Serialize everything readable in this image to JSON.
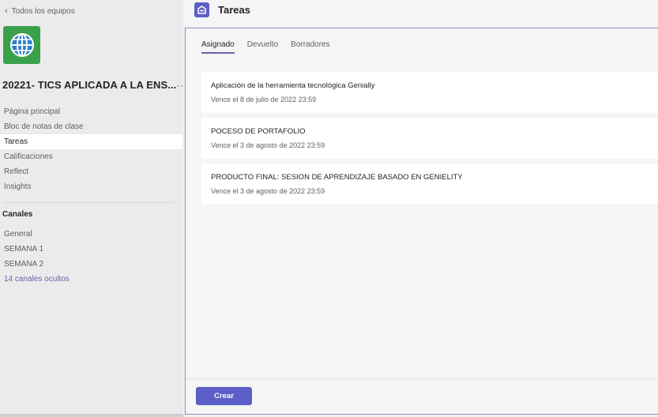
{
  "sidebar": {
    "back_label": "Todos los equipos",
    "team_name": "20221- TICS APLICADA A LA ENS...",
    "more_label": "···",
    "nav_items": [
      {
        "label": "Página principal"
      },
      {
        "label": "Bloc de notas de clase"
      },
      {
        "label": "Tareas"
      },
      {
        "label": "Calificaciones"
      },
      {
        "label": "Reflect"
      },
      {
        "label": "Insights"
      }
    ],
    "active_nav": "Tareas",
    "channels_title": "Canales",
    "channels": [
      {
        "label": "General"
      },
      {
        "label": "SEMANA 1"
      },
      {
        "label": "SEMANA 2"
      },
      {
        "label": "14 canales ocultos"
      }
    ]
  },
  "header": {
    "title": "Tareas",
    "icon": "assignments-icon"
  },
  "tabs": [
    {
      "label": "Asignado"
    },
    {
      "label": "Devuelto"
    },
    {
      "label": "Borradores"
    }
  ],
  "active_tab": "Asignado",
  "assignments": [
    {
      "title": "Aplicación de la herramienta tecnológica Genially",
      "due": "Vence el 8 de julio de 2022 23:59"
    },
    {
      "title": "POCESO DE PORTAFOLIO",
      "due": "Vence el 3 de agosto de 2022 23:59"
    },
    {
      "title": "PRODUCTO FINAL: SESION DE APRENDIZAJE BASADO EN GENIELITY",
      "due": "Vence el 3 de agosto de 2022 23:59"
    }
  ],
  "create_button": "Crear",
  "colors": {
    "accent": "#5b5fc7",
    "team_avatar": "#3aa14a",
    "link": "#6264a7"
  }
}
